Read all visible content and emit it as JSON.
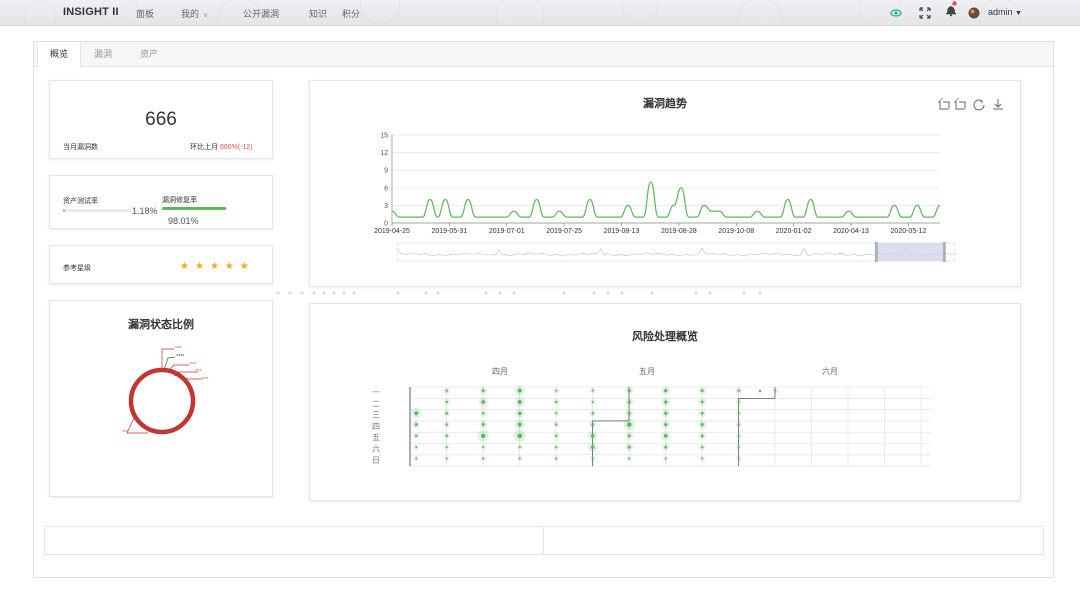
{
  "header": {
    "brand": "INSIGHT II",
    "nav": [
      {
        "label": "面板"
      },
      {
        "label": "我的",
        "has_dropdown": true
      },
      {
        "label": "公开漏洞"
      },
      {
        "label": "知识"
      },
      {
        "label": "积分"
      }
    ],
    "user": {
      "name": "admin"
    },
    "icons": [
      "eye-icon",
      "fullscreen-icon",
      "bell-icon",
      "avatar"
    ],
    "colors": {
      "eye": "#2ab27b",
      "notify_dot": "#e0544b"
    }
  },
  "tabs": [
    {
      "label": "概览",
      "active": true
    },
    {
      "label": "漏洞",
      "active": false
    },
    {
      "label": "资产",
      "active": false
    }
  ],
  "summary": {
    "vuln_count": "666",
    "vuln_count_label": "当月漏洞数",
    "mom_label": "环比上月",
    "mom_value": "666%(-12)"
  },
  "rates": {
    "asset_test_label": "资产测试率",
    "asset_test_value": "1.18%",
    "asset_test_fraction": 0.0118,
    "fix_label": "漏洞修复率",
    "fix_value": "98.01%",
    "fix_fraction": 0.9801,
    "fix_color": "#5cb85c"
  },
  "rating": {
    "label": "参考星级",
    "stars": 5,
    "color": "#f5a623"
  },
  "trend": {
    "title": "漏洞趋势",
    "toolbox": [
      "zoom-icon",
      "zoom-reset-icon",
      "restore-icon",
      "download-icon"
    ]
  },
  "status": {
    "title": "漏洞状态比例",
    "labels": [
      "***",
      "****",
      "***",
      "***",
      "***",
      "***"
    ],
    "ring_color": "#c23531"
  },
  "risk": {
    "title": "风险处理概览",
    "months": [
      "四月",
      "五月",
      "六月"
    ],
    "weekdays": [
      "一",
      "二",
      "三",
      "四",
      "五",
      "六",
      "日"
    ],
    "dot_color": "#5cb85c"
  },
  "chart_data": [
    {
      "type": "line",
      "title": "漏洞趋势",
      "x_ticks": [
        "2019-04-25",
        "2019-05-31",
        "2019-07-01",
        "2019-07-25",
        "2019-08-13",
        "2019-08-28",
        "2019-10-08",
        "2020-01-02",
        "2020-04-13",
        "2020-05-12"
      ],
      "ylim": [
        0,
        15
      ],
      "y_ticks": [
        0,
        3,
        6,
        9,
        12,
        15
      ],
      "grid": true,
      "series_color": "#5cb85c",
      "values": [
        2,
        1,
        1,
        1,
        1,
        4,
        1,
        4,
        1,
        1,
        4,
        1,
        1,
        1,
        1,
        1,
        2,
        1,
        1,
        4,
        1,
        1,
        2,
        1,
        1,
        1,
        4,
        1,
        1,
        1,
        1,
        3,
        1,
        1,
        7,
        1,
        1,
        3,
        6,
        1,
        1,
        3,
        2,
        2,
        1,
        1,
        1,
        1,
        2,
        1,
        1,
        1,
        4,
        1,
        1,
        4,
        1,
        1,
        1,
        1,
        2,
        1,
        1,
        1,
        1,
        1,
        3,
        1,
        1,
        3,
        1,
        1,
        3
      ],
      "datazoom_range": [
        0.86,
        0.98
      ]
    }
  ]
}
